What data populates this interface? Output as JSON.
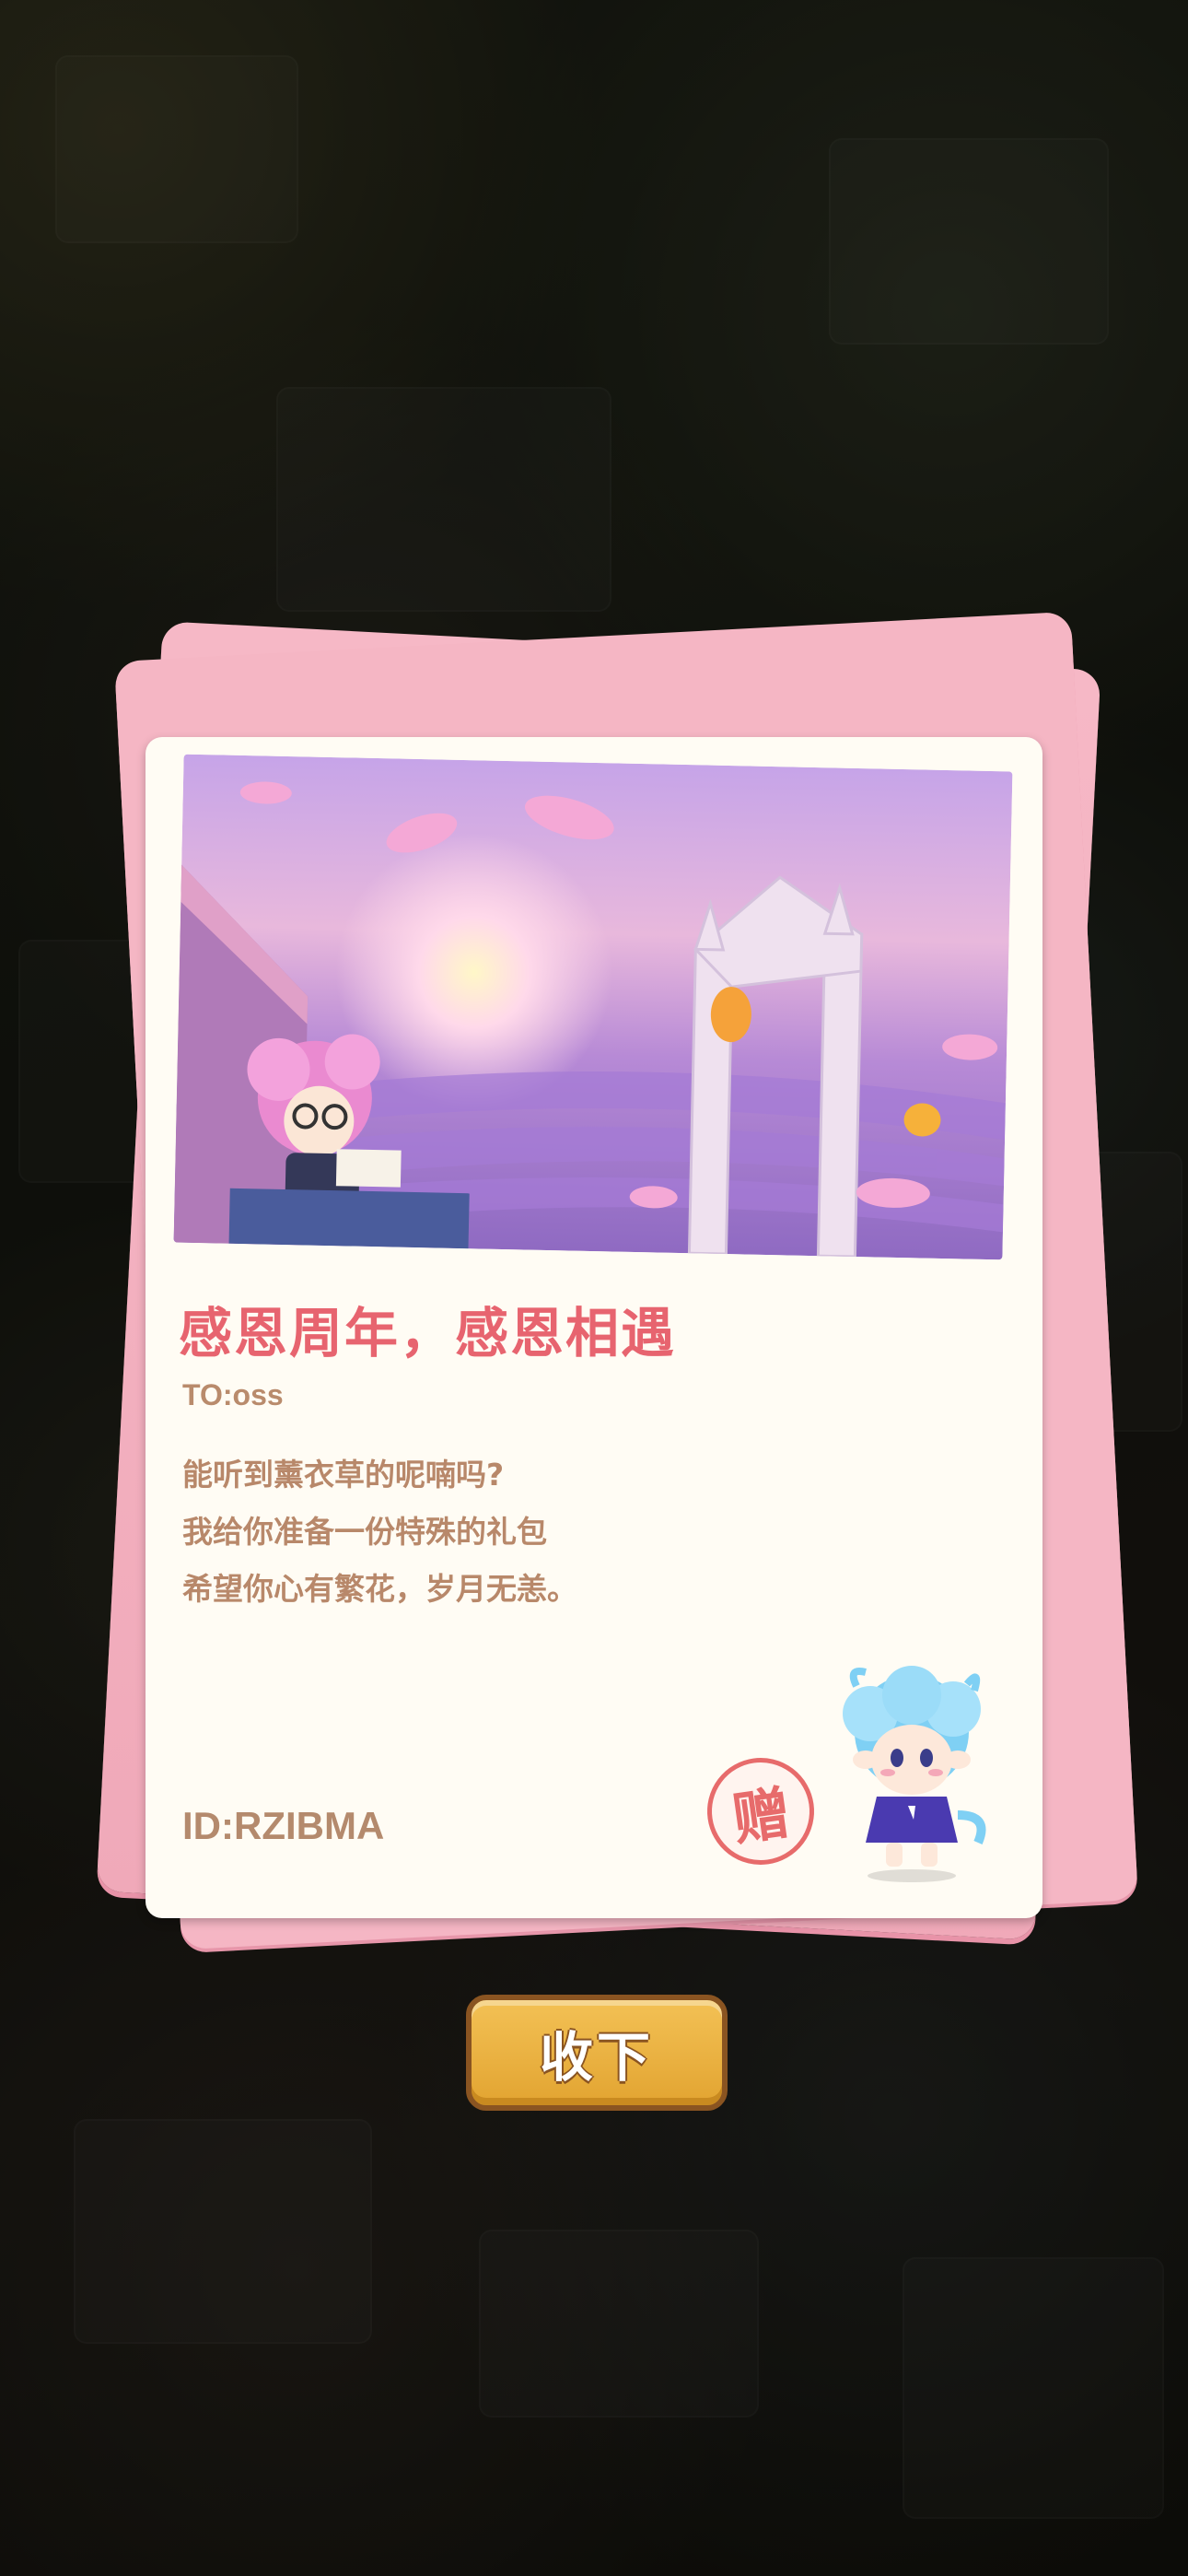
{
  "letter": {
    "title": "感恩周年，感恩相遇",
    "recipient": "TO:oss",
    "message_lines": [
      "能听到薰衣草的呢喃吗?",
      "我给你准备一份特殊的礼包",
      "希望你心有繁花，岁月无恙。"
    ],
    "player_id": "ID:RZIBMA",
    "stamp_text": "赠"
  },
  "actions": {
    "accept_label": "收下"
  },
  "colors": {
    "title": "#e7646f",
    "body_text": "#b8886a",
    "envelope": "#f6b8c6",
    "card": "#fffcf4",
    "button": "#e2a431",
    "button_border": "#8a5421",
    "stamp": "#e76b6b"
  }
}
